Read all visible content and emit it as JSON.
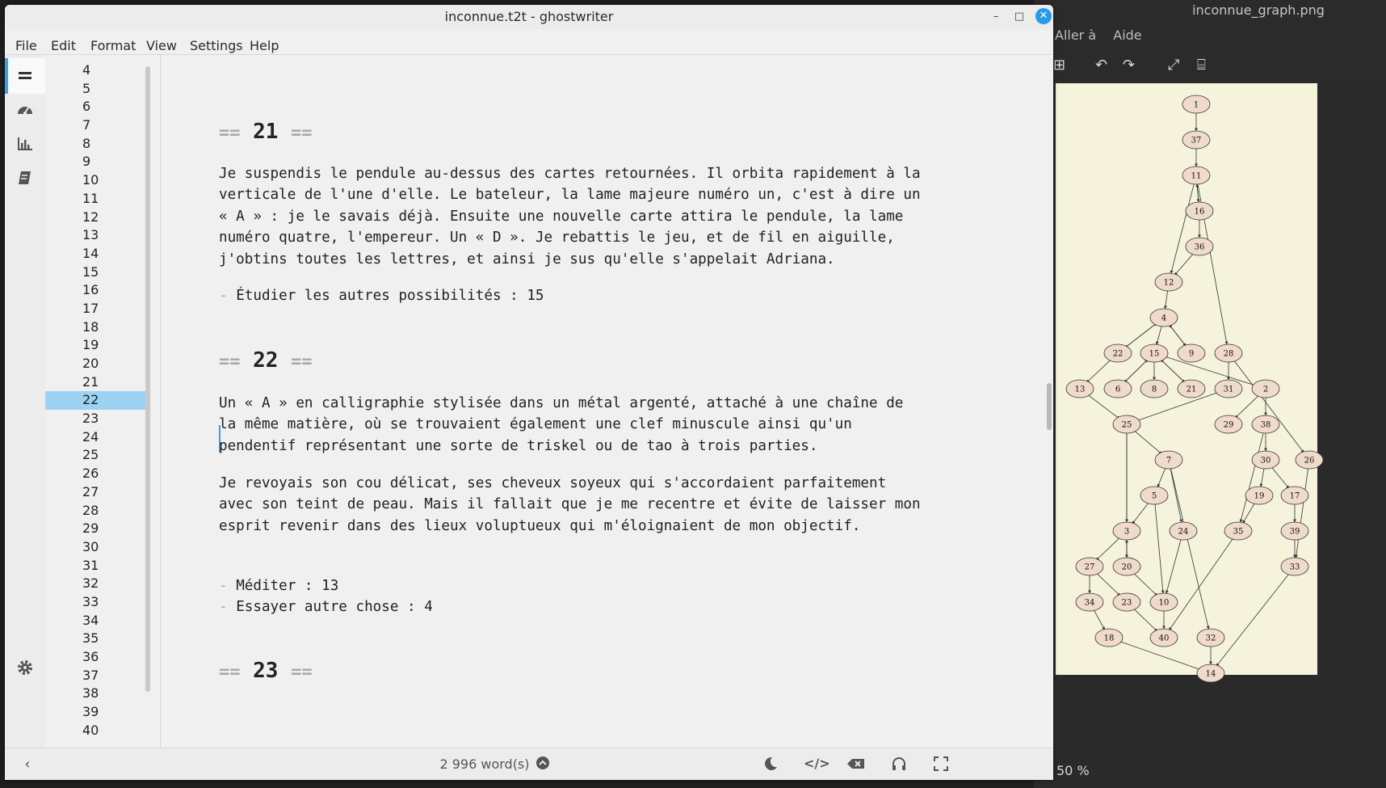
{
  "viewer": {
    "title": "inconnue_graph.png",
    "menu": [
      "Aller à",
      "Aide"
    ],
    "zoom": "50 %",
    "graph": {
      "nodes": [
        "1",
        "37",
        "11",
        "16",
        "36",
        "12",
        "4",
        "22",
        "15",
        "9",
        "28",
        "13",
        "6",
        "8",
        "21",
        "31",
        "2",
        "25",
        "29",
        "38",
        "7",
        "30",
        "26",
        "5",
        "19",
        "17",
        "3",
        "24",
        "35",
        "39",
        "27",
        "20",
        "33",
        "34",
        "23",
        "10",
        "18",
        "40",
        "32",
        "14"
      ],
      "bg_color": "#f5f3dc",
      "node_color": "#efdacb"
    }
  },
  "window": {
    "title": "inconnue.t2t - ghostwriter",
    "menu": {
      "file": "File",
      "edit": "Edit",
      "format": "Format",
      "view": "View",
      "settings": "Settings",
      "help": "Help"
    }
  },
  "outline": {
    "items": [
      "4",
      "5",
      "6",
      "7",
      "8",
      "9",
      "10",
      "11",
      "12",
      "13",
      "14",
      "15",
      "16",
      "17",
      "18",
      "19",
      "20",
      "21",
      "22",
      "23",
      "24",
      "25",
      "26",
      "27",
      "28",
      "29",
      "30",
      "31",
      "32",
      "33",
      "34",
      "35",
      "36",
      "37",
      "38",
      "39",
      "40"
    ],
    "selected": "22"
  },
  "editor": {
    "marker_left": "==",
    "marker_right": "==",
    "h21": "21",
    "p21": "Je suspendis le pendule au-dessus des cartes retournées. Il orbita rapidement à la\nverticale de l'une d'elle. Le bateleur, la lame majeure numéro un, c'est à dire un\n« A » : je le savais déjà. Ensuite une nouvelle carte attira le pendule, la lame\nnuméro quatre, l'empereur. Un « D ». Je rebattis le jeu, et de fil en aiguille,\nj'obtins toutes les lettres, et ainsi je sus qu'elle s'appelait Adriana.",
    "choice21": "Étudier les autres possibilités : 15",
    "h22": "22",
    "p22a": "Un « A » en calligraphie stylisée dans un métal argenté, attaché à une chaîne de\nla même matière, où se trouvaient également une clef minuscule ainsi qu'un\npendentif représentant une sorte de triskel ou de tao à trois parties.",
    "p22b": "Je revoyais son cou délicat, ses cheveux soyeux qui s'accordaient parfaitement\navec son teint de peau. Mais il fallait que je me recentre et évite de laisser mon\nesprit revenir dans des lieux voluptueux qui m'éloignaient de mon objectif.",
    "choice22a": "Méditer : 13",
    "choice22b": "Essayer autre chose : 4",
    "h23": "23",
    "dash": "-"
  },
  "status": {
    "word_count": "2 996 word(s)"
  },
  "colors": {
    "accent": "#3aa0e8",
    "selection": "#9dd2f2"
  }
}
